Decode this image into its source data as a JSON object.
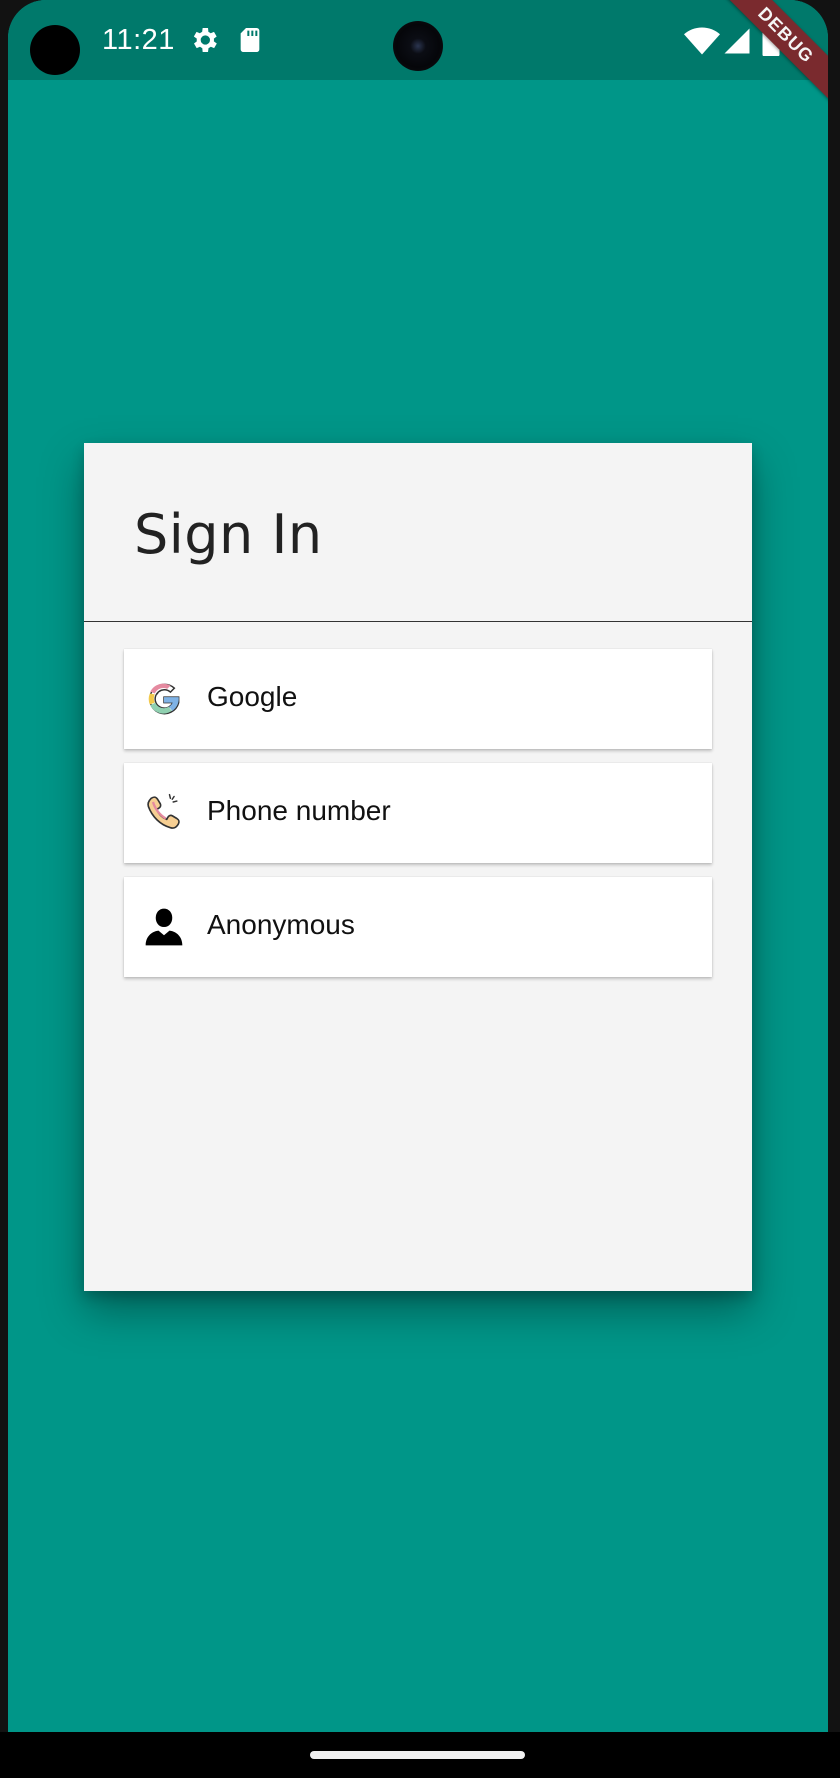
{
  "status_bar": {
    "time": "11:21",
    "debug_banner": "DEBUG",
    "icons": [
      "settings-icon",
      "sd-card-icon",
      "wifi-icon",
      "signal-icon",
      "battery-icon"
    ]
  },
  "dialog": {
    "title": "Sign In",
    "providers": [
      {
        "label": "Google",
        "icon": "google-logo-icon"
      },
      {
        "label": "Phone number",
        "icon": "phone-icon"
      },
      {
        "label": "Anonymous",
        "icon": "person-icon"
      }
    ]
  },
  "colors": {
    "app_background": "#009688",
    "status_bar": "#00796B",
    "dialog_background": "#F4F4F4",
    "button_background": "#FFFFFF",
    "debug_ribbon": "#7A2A2E"
  }
}
